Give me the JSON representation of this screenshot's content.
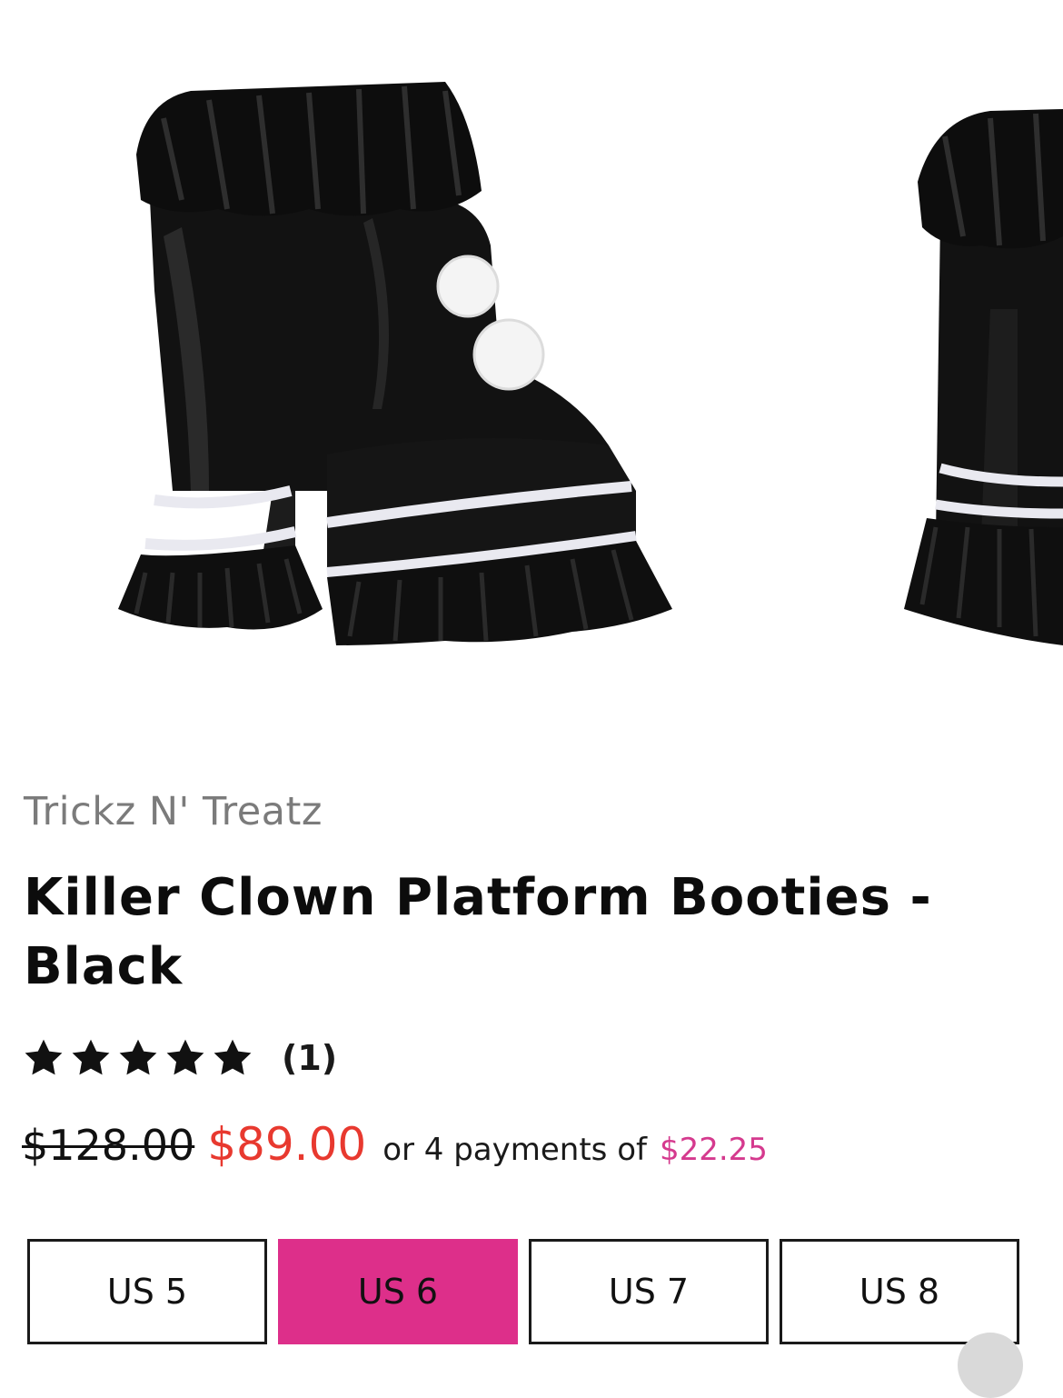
{
  "product": {
    "brand": "Trickz N' Treatz",
    "title": "Killer Clown Platform Booties - Black",
    "rating": {
      "stars": 5,
      "max_stars": 5,
      "review_count_label": "(1)"
    },
    "price": {
      "original": "$128.00",
      "sale": "$89.00",
      "installment_text": "or 4 payments of",
      "installment_amount": "$22.25"
    },
    "sizes": [
      {
        "label": "US 5",
        "selected": false
      },
      {
        "label": "US 6",
        "selected": true
      },
      {
        "label": "US 7",
        "selected": false
      },
      {
        "label": "US 8",
        "selected": false
      }
    ]
  },
  "colors": {
    "sale_price": "#e8392f",
    "installment": "#d53a8e",
    "selected_size": "#dd2f8a"
  },
  "icons": {
    "star": "star-filled-icon"
  }
}
